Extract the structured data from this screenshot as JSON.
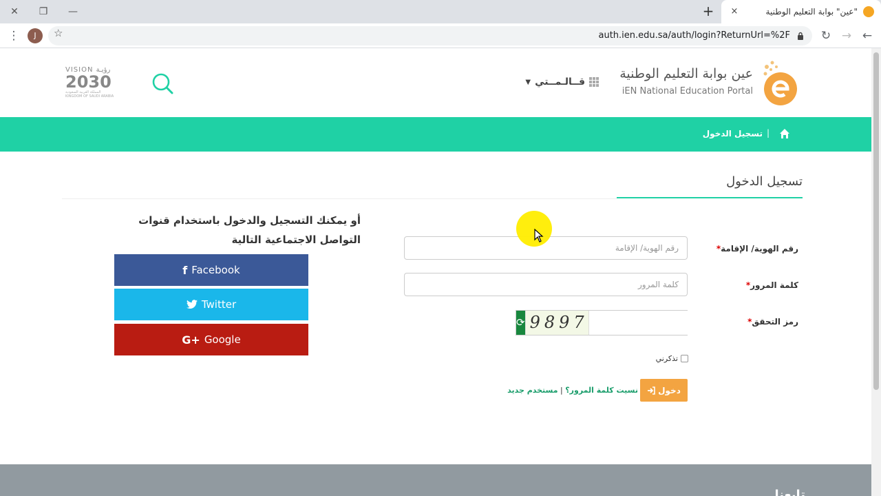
{
  "browser": {
    "tab_title": "\"عين\" بوابة التعليم الوطنية",
    "tab_close": "×",
    "new_tab": "+",
    "url": "auth.ien.edu.sa/auth/login?ReturnUrl=%2F",
    "avatar_letter": "J",
    "window_close": "✕",
    "window_restore": "❐",
    "window_minimize": "—"
  },
  "header": {
    "logo_ar": "عين بوابة التعليم الوطنية",
    "logo_en": "iEN National Education Portal",
    "menu_label": "قــالـمــتي",
    "vision_top": "VISION رؤيـة",
    "vision_year": "2030",
    "vision_sub": "المملكة العربية السعودية KINGDOM OF SAUDI ARABIA"
  },
  "breadcrumb": {
    "separator": "|",
    "current": "تسجيل الدخول"
  },
  "login": {
    "title": "تسجيل الدخول",
    "id_label": "رقم الهوية/ الإقامة",
    "id_placeholder": "رقم الهوية/ الإقامة",
    "password_label": "كلمة المرور",
    "password_placeholder": "كلمة المرور",
    "captcha_label": "رمز التحقق",
    "required_mark": "*",
    "captcha_code": "9897",
    "refresh_glyph": "⟳",
    "remember_label": "تذكرني",
    "login_button": "دخول",
    "forgot_password": "نسيت كلمة المرور؟",
    "links_separator": "|",
    "new_user": "مستخدم جديد"
  },
  "social": {
    "intro": "أو يمكنك التسجيل والدخول باستخدام قنوات التواصل الاجتماعية التالية",
    "facebook_icon": "f",
    "facebook": "Facebook",
    "twitter_icon": "🐦",
    "twitter": "Twitter",
    "google_icon": "G+",
    "google": "Google"
  },
  "footer": {
    "title": "تابعنا"
  },
  "colors": {
    "accent": "#1fd1a5",
    "facebook": "#3b5998",
    "twitter": "#1ab7ea",
    "google": "#b91c12",
    "login_button": "#f3a441",
    "captcha_refresh": "#18873e"
  }
}
